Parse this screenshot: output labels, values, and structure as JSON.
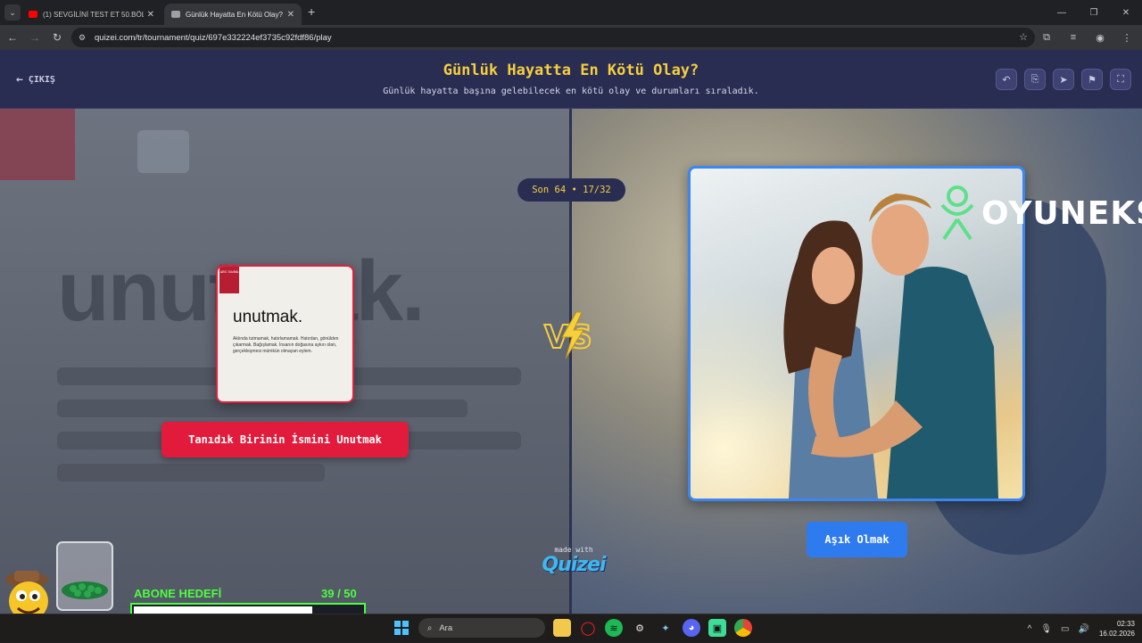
{
  "browser": {
    "tabs": [
      {
        "title": "(1) SEVGİLİNİ TEST ET 50.BÖLÜM",
        "active": false,
        "favicon_color": "#ff0000"
      },
      {
        "title": "Günlük Hayatta En Kötü Olay? -",
        "active": true,
        "favicon_color": "#9aa0a6"
      }
    ],
    "url": "quizei.com/tr/tournament/quiz/697e332224ef3735c92fdf86/play"
  },
  "header": {
    "exit_label": "ÇIKIŞ",
    "title": "Günlük Hayatta En Kötü Olay?",
    "subtitle": "Günlük hayatta başına gelebilecek en kötü olay ve durumları sıraladık.",
    "buttons": [
      "undo-icon",
      "share-icon",
      "send-icon",
      "flag-icon",
      "fullscreen-icon"
    ]
  },
  "round": {
    "label": "Son 64 • 17/32"
  },
  "left_option": {
    "card": {
      "tag": "ABC Sözlük",
      "word": "unutmak.",
      "definition": "Aklında tutmamak, hatırlamamak. Hatırdan, gönülden çıkarmak. Bağışlamak. İnsanın doğasına aykırı olan, gerçekleşmesi mümkün olmayan eylem."
    },
    "label": "Tanıdık Birinin İsmini Unutmak",
    "color": "#e21b3c"
  },
  "right_option": {
    "label": "Aşık Olmak",
    "color": "#2e7bf0"
  },
  "background": {
    "left_word": "unutmak."
  },
  "watermark": "OYUNEKS",
  "footer": {
    "made_with": "made with",
    "brand": "Quizei"
  },
  "stream_overlay": {
    "goal_label": "ABONE HEDEFİ",
    "goal_count": "39  / 50",
    "current": 39,
    "target": 50
  },
  "taskbar": {
    "search_label": "Ara",
    "time": "02:33",
    "date": "16.02.2026"
  }
}
